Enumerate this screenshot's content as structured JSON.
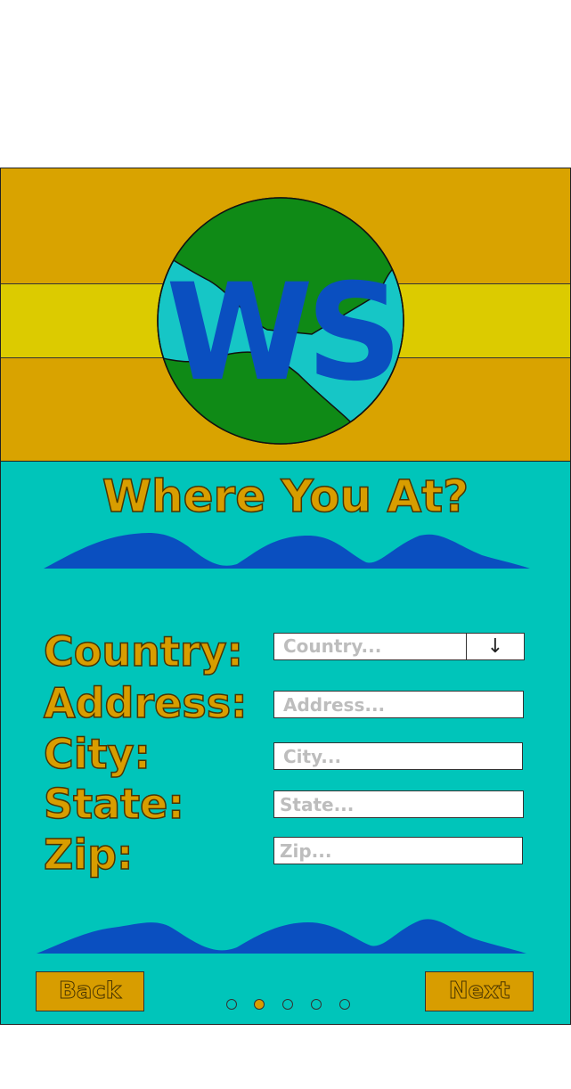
{
  "header": {
    "logo_text": "WS"
  },
  "page": {
    "title": "Where You At?"
  },
  "form": {
    "fields": [
      {
        "label": "Country:",
        "placeholder": "Country...",
        "type": "select"
      },
      {
        "label": "Address:",
        "placeholder": "Address...",
        "type": "text"
      },
      {
        "label": "City:",
        "placeholder": "City...",
        "type": "text"
      },
      {
        "label": "State:",
        "placeholder": "State...",
        "type": "text"
      },
      {
        "label": "Zip:",
        "placeholder": "Zip...",
        "type": "text"
      }
    ],
    "dropdown_icon": "↓"
  },
  "nav": {
    "back_label": "Back",
    "next_label": "Next",
    "page_indicator": {
      "total": 5,
      "current": 2
    }
  },
  "colors": {
    "header_gold": "#d9a300",
    "band_yellow": "#dccb00",
    "content_teal": "#00c5ba",
    "wave_blue": "#0a4fc0",
    "globe_green": "#0f8a16",
    "globe_water": "#16c6c6",
    "label_gold": "#d89d00"
  }
}
